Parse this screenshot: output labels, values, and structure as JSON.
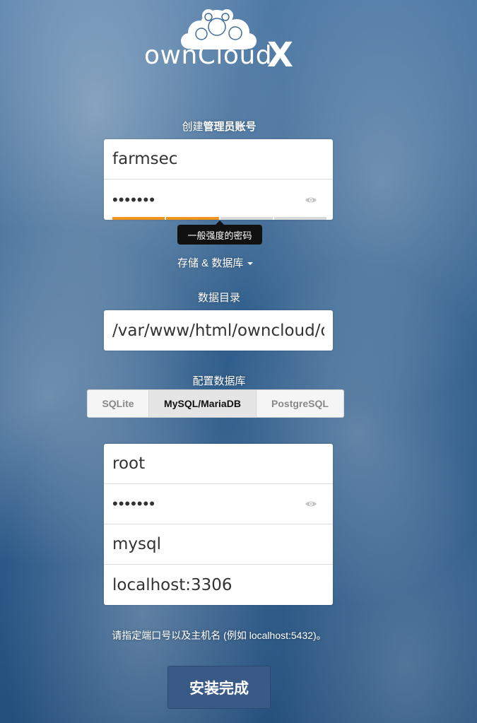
{
  "logo": {
    "text": "ownCloud",
    "mark": "X"
  },
  "admin": {
    "label_prefix": "创建",
    "label_bold": "管理员账号",
    "username": "farmsec",
    "password_mask": "•••••••",
    "password_strength_segments": 4,
    "password_strength_filled": 2,
    "strength_tooltip": "一般强度的密码"
  },
  "advanced_toggle": "存储 & 数据库",
  "data_dir": {
    "label": "数据目录",
    "value": "/var/www/html/owncloud/data"
  },
  "database": {
    "label": "配置数据库",
    "tabs": [
      "SQLite",
      "MySQL/MariaDB",
      "PostgreSQL"
    ],
    "active_tab": "MySQL/MariaDB",
    "user": "root",
    "password_mask": "•••••••",
    "name": "mysql",
    "host": "localhost:3306"
  },
  "host_hint": "请指定端口号以及主机名 (例如 localhost:5432)。",
  "submit_label": "安装完成",
  "colors": {
    "strength_on": "#f0941a",
    "submit_bg": "#395a86"
  }
}
